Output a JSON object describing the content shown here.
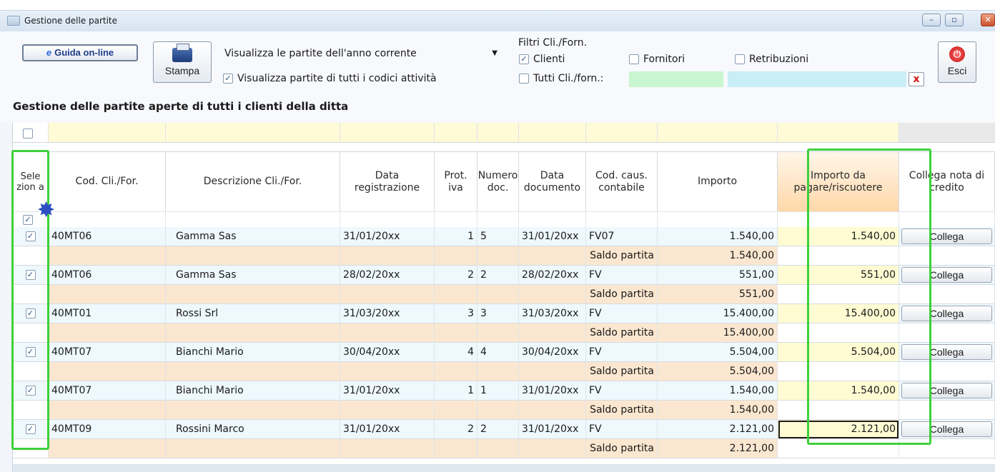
{
  "window": {
    "title": "Gestione delle partite",
    "controls": {
      "minimize": "–",
      "restore": "▫",
      "close": "✕"
    }
  },
  "toolbar": {
    "guida_label": "Guida on-line",
    "guida_icon": "e",
    "stampa_label": "Stampa",
    "periodo_select": "Visualizza le partite dell'anno corrente",
    "tutti_codici_label": "Visualizza partite di tutti i codici attività",
    "tutti_codici_checked": "✓",
    "filtri_title": "Filtri Cli./Forn.",
    "clienti_label": "Clienti",
    "clienti_checked": "✓",
    "fornitori_label": "Fornitori",
    "retribuzioni_label": "Retribuzioni",
    "tutti_cliforn_label": "Tutti Cli./forn.:",
    "clear_label": "x",
    "esci_label": "Esci",
    "esci_icon": "⏻"
  },
  "section_title": "Gestione delle partite aperte di tutti i clienti della ditta",
  "columns": {
    "seleziona": "Sele zion a",
    "cod": "Cod. Cli./For.",
    "descrizione": "Descrizione Cli./For.",
    "data_reg": "Data registrazione",
    "prot": "Prot. iva",
    "numero": "Numero doc.",
    "data_doc": "Data documento",
    "caus": "Cod. caus. contabile",
    "importo": "Importo",
    "importo_da": "Importo da pagare/riscuotere",
    "collega": "Collega nota di credito"
  },
  "check_mark": "✓",
  "saldo_label": "Saldo partita",
  "collega_label": "Collega",
  "rows": [
    {
      "cod": "40MT06",
      "descr": "Gamma Sas",
      "data_reg": "31/01/20xx",
      "prot": "1",
      "num": "5",
      "data_doc": "31/01/20xx",
      "caus": "FV07",
      "importo": "1.540,00",
      "importo_da": "1.540,00",
      "saldo": "1.540,00"
    },
    {
      "cod": "40MT06",
      "descr": "Gamma Sas",
      "data_reg": "28/02/20xx",
      "prot": "2",
      "num": "2",
      "data_doc": "28/02/20xx",
      "caus": "FV",
      "importo": "551,00",
      "importo_da": "551,00",
      "saldo": "551,00"
    },
    {
      "cod": "40MT01",
      "descr": "Rossi Srl",
      "data_reg": "31/03/20xx",
      "prot": "3",
      "num": "3",
      "data_doc": "31/03/20xx",
      "caus": "FV",
      "importo": "15.400,00",
      "importo_da": "15.400,00",
      "saldo": "15.400,00"
    },
    {
      "cod": "40MT07",
      "descr": "Bianchi Mario",
      "data_reg": "30/04/20xx",
      "prot": "4",
      "num": "4",
      "data_doc": "30/04/20xx",
      "caus": "FV",
      "importo": "5.504,00",
      "importo_da": "5.504,00",
      "saldo": "5.504,00"
    },
    {
      "cod": "40MT07",
      "descr": "Bianchi Mario",
      "data_reg": "31/01/20xx",
      "prot": "1",
      "num": "1",
      "data_doc": "31/01/20xx",
      "caus": "FV",
      "importo": "1.540,00",
      "importo_da": "1.540,00",
      "saldo": "1.540,00"
    },
    {
      "cod": "40MT09",
      "descr": "Rossini Marco",
      "data_reg": "31/01/20xx",
      "prot": "2",
      "num": "2",
      "data_doc": "31/01/20xx",
      "caus": "FV",
      "importo": "2.121,00",
      "importo_da": "2.121,00",
      "saldo": "2.121,00"
    }
  ],
  "colors": {
    "highlight": "#3dd13a",
    "saldo_row": "#fbe7d0",
    "main_row": "#eef8fd",
    "filter_cell": "#fffbd6"
  }
}
